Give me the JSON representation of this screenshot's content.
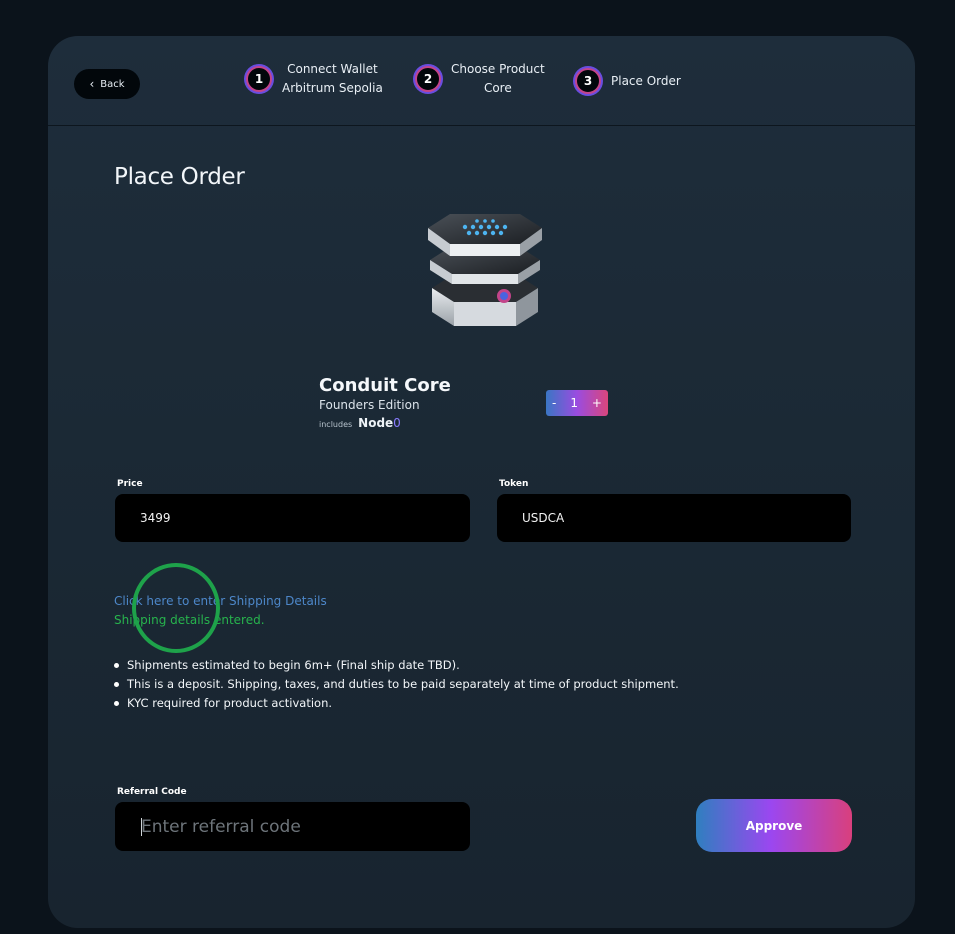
{
  "header": {
    "back_label": "Back",
    "steps": [
      {
        "number": "1",
        "line1": "Connect Wallet",
        "line2": "Arbitrum Sepolia"
      },
      {
        "number": "2",
        "line1": "Choose Product",
        "line2": "Core"
      },
      {
        "number": "3",
        "line1": "Place Order",
        "line2": ""
      }
    ]
  },
  "page": {
    "title": "Place Order"
  },
  "product": {
    "name": "Conduit Core",
    "edition": "Founders Edition",
    "includes_label": "includes",
    "node_brand": "Node",
    "node_suffix": "0",
    "quantity": "1",
    "minus": "-",
    "plus": "+"
  },
  "price": {
    "label": "Price",
    "value": "3499"
  },
  "token": {
    "label": "Token",
    "value": "USDCA"
  },
  "shipping": {
    "link_text": "Click here to enter Shipping Details",
    "status_text": "Shipping details entered."
  },
  "notes": [
    "Shipments estimated to begin 6m+ (Final ship date TBD).",
    "This is a deposit. Shipping, taxes, and duties to be paid separately at time of product shipment.",
    "KYC required for product activation."
  ],
  "referral": {
    "label": "Referral Code",
    "placeholder": "Enter referral code",
    "value": ""
  },
  "approve_label": "Approve",
  "colors": {
    "background": "#0b131b",
    "panel": "#1e2d3b",
    "link": "#4d87c9",
    "success": "#27b34d",
    "gradient_start": "#2f7fbf",
    "gradient_mid": "#9b47f0",
    "gradient_end": "#d9407d"
  }
}
